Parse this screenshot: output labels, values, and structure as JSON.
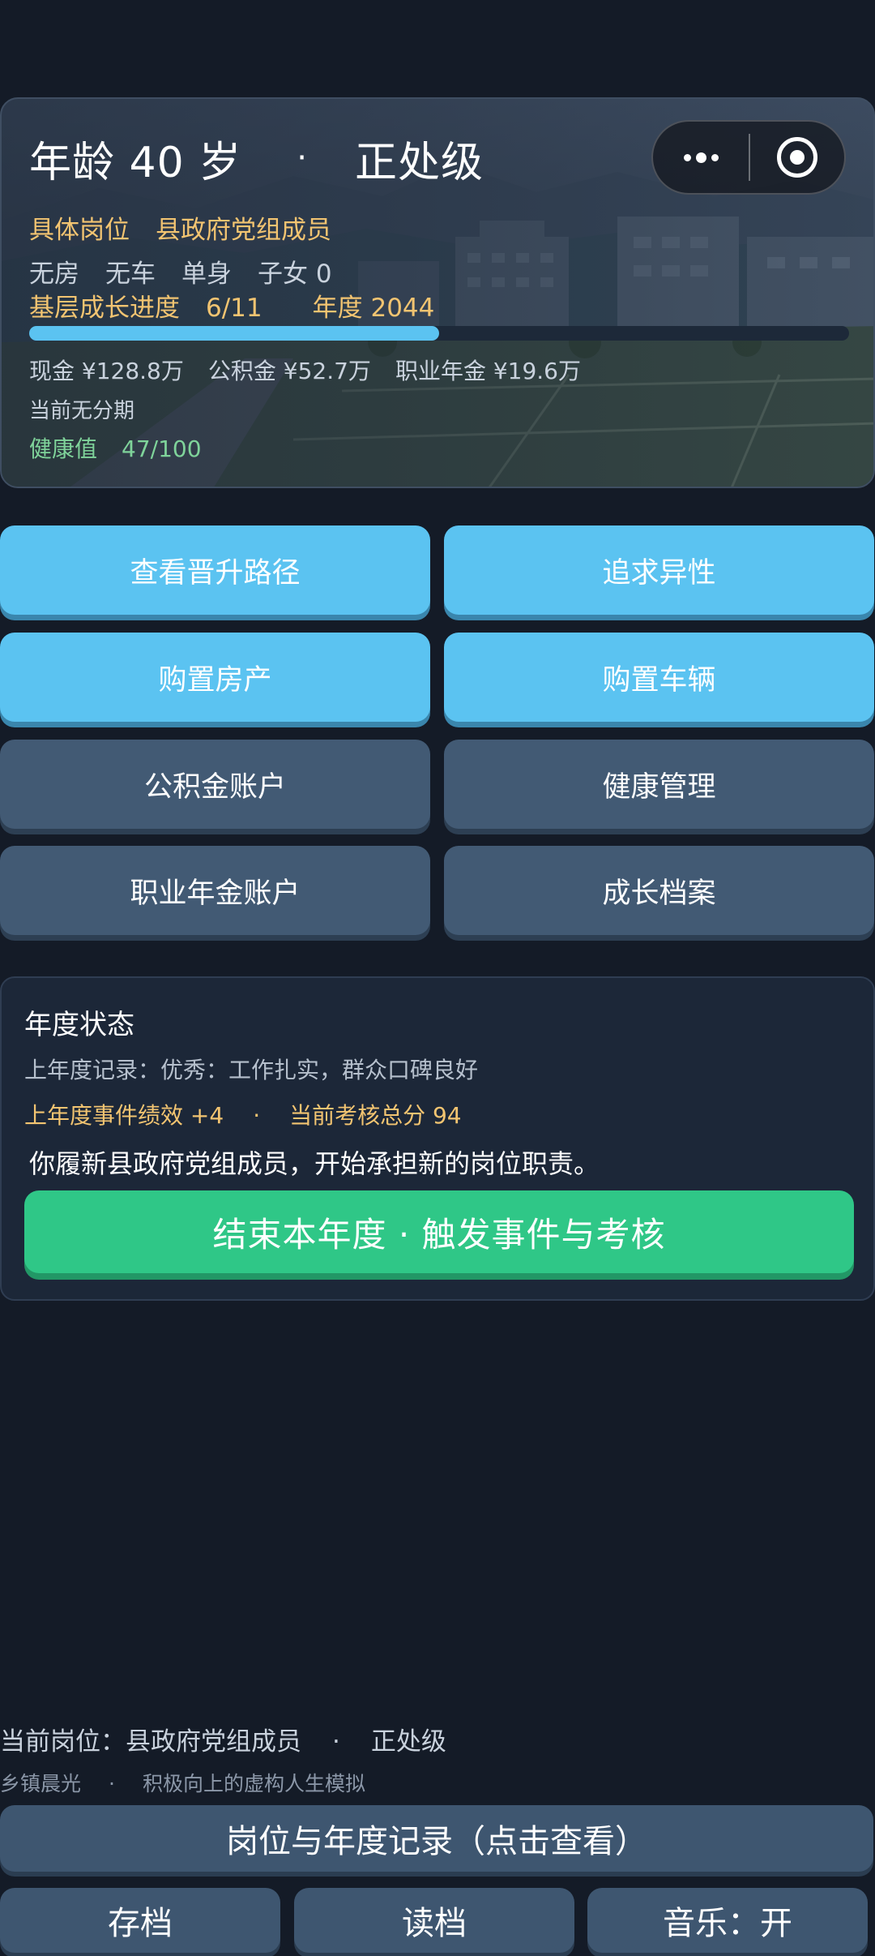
{
  "header": {
    "age_text": "年龄 40 岁",
    "separator": "·",
    "rank": "正处级",
    "position_label": "具体岗位",
    "position_value": "县政府党组成员",
    "assets": [
      "无房",
      "无车",
      "单身",
      "子女 0"
    ],
    "progress_label": "基层成长进度",
    "progress_value": "6/11",
    "year_text": "年度 2044",
    "progress_fraction": 0.5,
    "finance": [
      "现金 ¥128.8万",
      "公积金 ¥52.7万",
      "职业年金 ¥19.6万"
    ],
    "installment": "当前无分期",
    "health_label": "健康值",
    "health_value": "47/100"
  },
  "capsule": {
    "more_icon": "more-dots-icon",
    "close_icon": "target-circle-icon"
  },
  "actions": [
    {
      "label": "查看晋升路径",
      "style": "blue"
    },
    {
      "label": "追求异性",
      "style": "blue"
    },
    {
      "label": "购置房产",
      "style": "blue"
    },
    {
      "label": "购置车辆",
      "style": "blue"
    },
    {
      "label": "公积金账户",
      "style": "slate"
    },
    {
      "label": "健康管理",
      "style": "slate"
    },
    {
      "label": "职业年金账户",
      "style": "slate"
    },
    {
      "label": "成长档案",
      "style": "slate"
    }
  ],
  "status": {
    "title": "年度状态",
    "last_year_record": "上年度记录：优秀：工作扎实，群众口碑良好",
    "event_score": "上年度事件绩效 +4",
    "separator": "·",
    "total_score": "当前考核总分 94",
    "message": "你履新县政府党组成员，开始承担新的岗位职责。",
    "end_button": "结束本年度 · 触发事件与考核"
  },
  "footer": {
    "current_position": "当前岗位：县政府党组成员",
    "separator": "·",
    "current_rank": "正处级",
    "game_name": "乡镇晨光",
    "tagline": "积极向上的虚构人生模拟",
    "record_button": "岗位与年度记录（点击查看）",
    "save_button": "存档",
    "load_button": "读档",
    "music_button": "音乐：开"
  },
  "colors": {
    "background": "#141b27",
    "accent_blue": "#5bc3f1",
    "slate_button": "#425a74",
    "gold_text": "#f2c471",
    "green_text": "#7fd39a",
    "green_button": "#2fc787"
  }
}
